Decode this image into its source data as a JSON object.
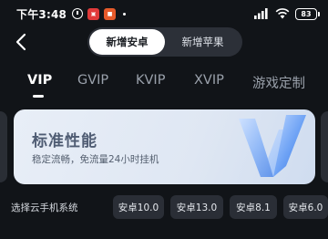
{
  "status_bar": {
    "time": "下午3:48",
    "battery": "83",
    "app_icon_1_color": "#e03a3a",
    "app_icon_2_color": "#e55a2a",
    "signal": "signal-icon",
    "wifi": "wifi-icon"
  },
  "header": {
    "segments": [
      "新增安卓",
      "新增苹果"
    ],
    "active_segment": "新增安卓"
  },
  "tabs": [
    {
      "label": "VIP",
      "active": true
    },
    {
      "label": "GVIP",
      "active": false
    },
    {
      "label": "KVIP",
      "active": false
    },
    {
      "label": "XVIP",
      "active": false
    },
    {
      "label": "游戏定制",
      "active": false
    }
  ],
  "plan": {
    "title": "标准性能",
    "description": "稳定流畅，免流量24小时挂机",
    "badge_icon": "v-logo-icon"
  },
  "system": {
    "label": "选择云手机系统",
    "versions": [
      "安卓10.0",
      "安卓13.0",
      "安卓8.1",
      "安卓6.0"
    ]
  },
  "colors": {
    "background": "#111418",
    "card": "#e3eaf5",
    "chip": "#2a2e36"
  }
}
